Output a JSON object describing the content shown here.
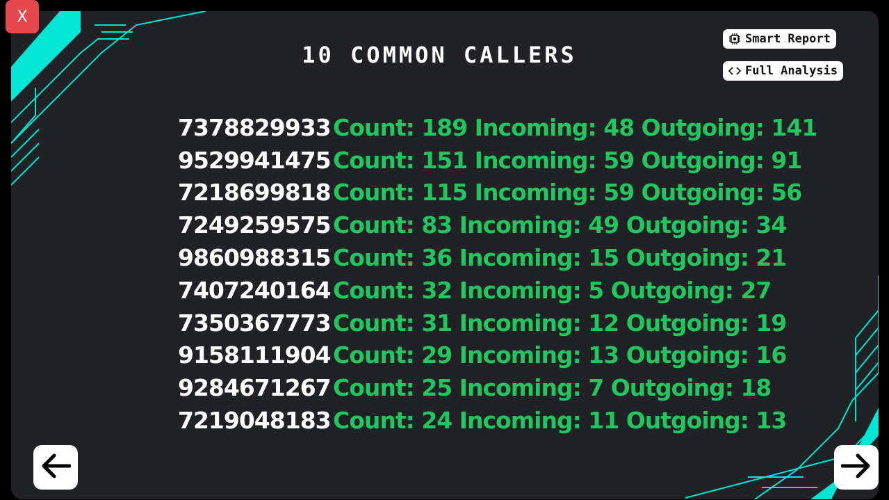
{
  "close_label": "X",
  "title": "10 COMMON CALLERS",
  "actions": {
    "smart_report": "Smart Report",
    "full_analysis": "Full Analysis"
  },
  "callers": [
    {
      "number": "7378829933",
      "count": "Count: 189",
      "incoming": "Incoming: 48",
      "outgoing": "Outgoing: 141"
    },
    {
      "number": "9529941475",
      "count": "Count: 151",
      "incoming": "Incoming: 59",
      "outgoing": "Outgoing: 91"
    },
    {
      "number": "7218699818",
      "count": "Count: 115",
      "incoming": "Incoming: 59",
      "outgoing": "Outgoing: 56"
    },
    {
      "number": "7249259575",
      "count": "Count: 83",
      "incoming": "Incoming: 49",
      "outgoing": "Outgoing: 34"
    },
    {
      "number": "9860988315",
      "count": "Count: 36",
      "incoming": "Incoming: 15",
      "outgoing": "Outgoing: 21"
    },
    {
      "number": "7407240164",
      "count": "Count: 32",
      "incoming": "Incoming: 5",
      "outgoing": "Outgoing: 27"
    },
    {
      "number": "7350367773",
      "count": "Count: 31",
      "incoming": "Incoming: 12",
      "outgoing": "Outgoing: 19"
    },
    {
      "number": "9158111904",
      "count": "Count: 29",
      "incoming": "Incoming: 13",
      "outgoing": "Outgoing: 16"
    },
    {
      "number": "9284671267",
      "count": "Count: 25",
      "incoming": "Incoming: 7",
      "outgoing": "Outgoing: 18"
    },
    {
      "number": "7219048183",
      "count": "Count: 24",
      "incoming": "Incoming: 11",
      "outgoing": "Outgoing: 13"
    }
  ],
  "colors": {
    "accent": "#00e5d4",
    "count_text": "#22c55e",
    "close": "#e5484d",
    "panel": "#212226"
  },
  "icons": {
    "close": "x-icon",
    "smart_report": "chip-icon",
    "full_analysis": "code-icon",
    "prev": "arrow-left-icon",
    "next": "arrow-right-icon"
  }
}
